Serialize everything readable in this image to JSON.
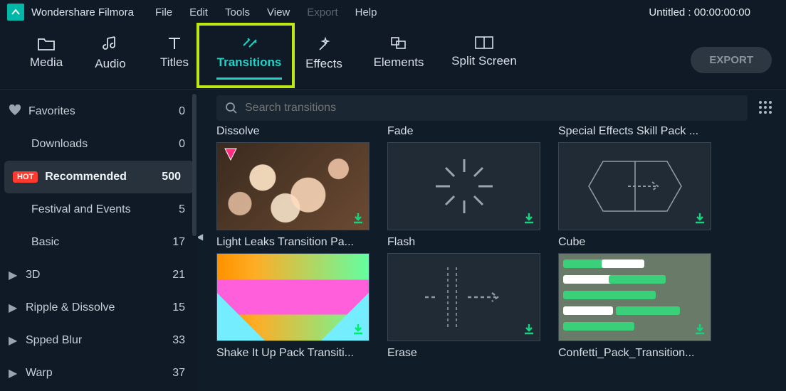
{
  "app": {
    "title": "Wondershare Filmora"
  },
  "menu": {
    "file": "File",
    "edit": "Edit",
    "tools": "Tools",
    "view": "View",
    "export": "Export",
    "help": "Help"
  },
  "project": {
    "title": "Untitled : 00:00:00:00"
  },
  "tabs": {
    "media": "Media",
    "audio": "Audio",
    "titles": "Titles",
    "transitions": "Transitions",
    "effects": "Effects",
    "elements": "Elements",
    "split_screen": "Split Screen"
  },
  "export_btn": "EXPORT",
  "search": {
    "placeholder": "Search transitions"
  },
  "sidebar": {
    "favorites": {
      "label": "Favorites",
      "count": "0"
    },
    "downloads": {
      "label": "Downloads",
      "count": "0"
    },
    "recommended": {
      "label": "Recommended",
      "count": "500",
      "badge": "HOT"
    },
    "festival": {
      "label": "Festival and Events",
      "count": "5"
    },
    "basic": {
      "label": "Basic",
      "count": "17"
    },
    "threeD": {
      "label": "3D",
      "count": "21"
    },
    "ripple": {
      "label": "Ripple & Dissolve",
      "count": "15"
    },
    "speed": {
      "label": "Spped Blur",
      "count": "33"
    },
    "warp": {
      "label": "Warp",
      "count": "37"
    }
  },
  "row0": {
    "a": "Dissolve",
    "b": "Fade",
    "c": "Special Effects Skill Pack ..."
  },
  "row1": {
    "a": "Light Leaks Transition Pa...",
    "b": "Flash",
    "c": "Cube"
  },
  "row2": {
    "a": "Shake It Up Pack Transiti...",
    "b": "Erase",
    "c": "Confetti_Pack_Transition..."
  }
}
